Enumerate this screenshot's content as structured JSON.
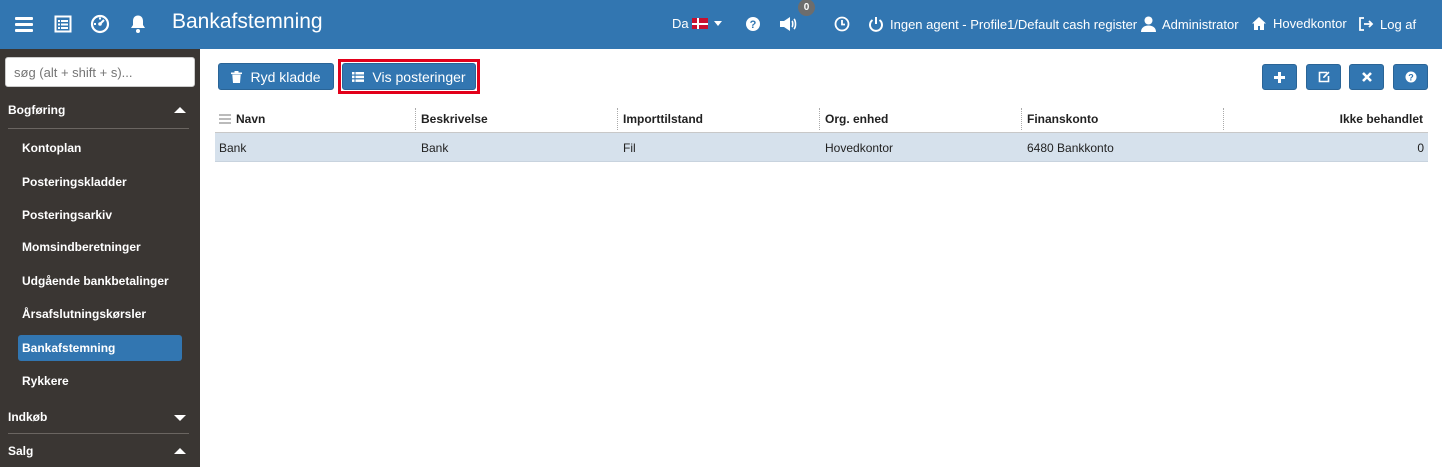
{
  "header": {
    "title": "Bankafstemning",
    "language": "Da",
    "notification_count": "0",
    "agent_status": "Ingen agent - Profile1/Default cash register",
    "user": "Administrator",
    "location": "Hovedkontor",
    "logout": "Log af",
    "accent_color": "#3276b1"
  },
  "sidebar": {
    "search_placeholder": "søg (alt + shift + s)...",
    "groups": [
      {
        "label": "Bogføring",
        "expanded": true,
        "items": [
          {
            "label": "Kontoplan"
          },
          {
            "label": "Posteringskladder"
          },
          {
            "label": "Posteringsarkiv"
          },
          {
            "label": "Momsindberetninger"
          },
          {
            "label": "Udgående bankbetalinger"
          },
          {
            "label": "Årsafslutningskørsler"
          },
          {
            "label": "Bankafstemning",
            "active": true
          },
          {
            "label": "Rykkere"
          }
        ]
      },
      {
        "label": "Indkøb",
        "expanded": false
      },
      {
        "label": "Salg",
        "expanded": true
      }
    ]
  },
  "toolbar": {
    "clear_label": "Ryd kladde",
    "show_postings_label": "Vis posteringer",
    "icons": [
      "plus-icon",
      "edit-icon",
      "close-icon",
      "help-icon"
    ]
  },
  "table": {
    "columns": [
      "Navn",
      "Beskrivelse",
      "Importtilstand",
      "Org. enhed",
      "Finanskonto",
      "Ikke behandlet"
    ],
    "rows": [
      [
        "Bank",
        "Bank",
        "Fil",
        "Hovedkontor",
        "6480 Bankkonto",
        "0"
      ]
    ]
  }
}
